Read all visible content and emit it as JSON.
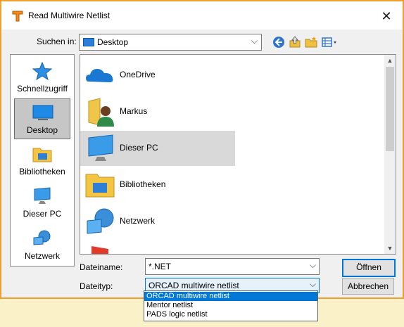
{
  "window": {
    "title": "Read Multiwire Netlist"
  },
  "toolbar": {
    "look_in_label": "Suchen in:",
    "look_in_value": "Desktop"
  },
  "places": [
    {
      "label": "Schnellzugriff",
      "icon": "star-icon"
    },
    {
      "label": "Desktop",
      "icon": "desktop-icon",
      "selected": true
    },
    {
      "label": "Bibliotheken",
      "icon": "library-icon"
    },
    {
      "label": "Dieser PC",
      "icon": "computer-icon"
    },
    {
      "label": "Netzwerk",
      "icon": "network-icon"
    }
  ],
  "files": [
    {
      "label": "OneDrive",
      "icon": "cloud-icon"
    },
    {
      "label": "Markus",
      "icon": "user-folder-icon"
    },
    {
      "label": "Dieser PC",
      "icon": "computer-icon",
      "selected": true
    },
    {
      "label": "Bibliotheken",
      "icon": "library-icon"
    },
    {
      "label": "Netzwerk",
      "icon": "network-icon"
    }
  ],
  "filename": {
    "label": "Dateiname:",
    "value": "*.NET"
  },
  "filetype": {
    "label": "Dateityp:",
    "value": "ORCAD multiwire netlist",
    "options": [
      "ORCAD multiwire netlist",
      "Mentor netlist",
      "PADS logic netlist"
    ]
  },
  "buttons": {
    "open": "Öffnen",
    "cancel": "Abbrechen"
  },
  "colors": {
    "accent": "#0078d7",
    "frame": "#f0a030",
    "selection": "#d9d9d9"
  }
}
